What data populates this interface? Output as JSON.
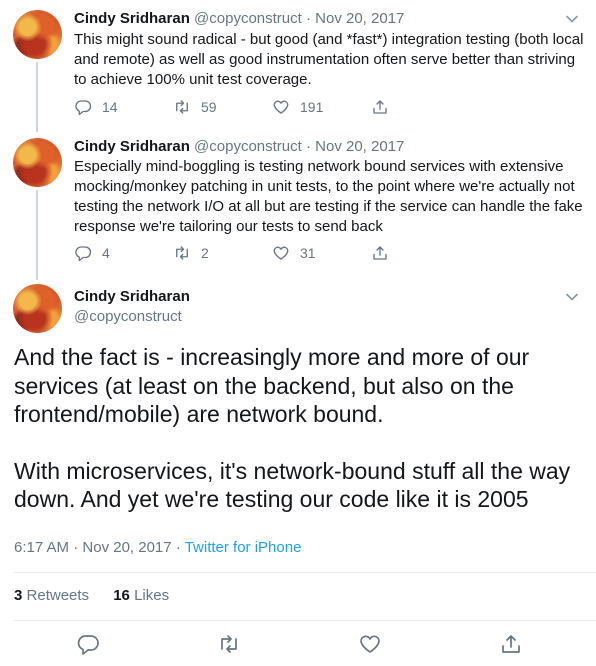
{
  "tweets": [
    {
      "name": "Cindy Sridharan",
      "handle": "@copyconstruct",
      "separator": "·",
      "date": "Nov 20, 2017",
      "text": "This might sound radical - but good (and *fast*) integration testing (both local and remote) as well as good instrumentation often serve better than striving to achieve 100% unit test coverage.",
      "replies": "14",
      "retweets": "59",
      "likes": "191"
    },
    {
      "name": "Cindy Sridharan",
      "handle": "@copyconstruct",
      "separator": "·",
      "date": "Nov 20, 2017",
      "text": "Especially mind-boggling is testing network bound services with extensive mocking/monkey patching in unit tests, to the point where we're actually not testing the network I/O at all but are testing if the service can handle the fake response we're tailoring our tests to send back",
      "replies": "4",
      "retweets": "2",
      "likes": "31"
    }
  ],
  "main_tweet": {
    "name": "Cindy Sridharan",
    "handle": "@copyconstruct",
    "paragraph1": "And the fact is - increasingly more and more of our services (at least on the backend, but also on the frontend/mobile) are network bound.",
    "paragraph2": "With microservices, it's network-bound stuff all the way down. And yet we're testing our code like it is 2005",
    "time": "6:17 AM",
    "separator1": "·",
    "date": "Nov 20, 2017",
    "separator2": "·",
    "source": "Twitter for iPhone",
    "retweet_count": "3",
    "retweet_label": "Retweets",
    "like_count": "16",
    "like_label": "Likes"
  },
  "icons": {
    "reply": "reply-icon",
    "retweet": "retweet-icon",
    "like": "heart-icon",
    "share": "share-icon",
    "caret": "chevron-down-icon"
  },
  "colors": {
    "text": "#14171a",
    "muted": "#657786",
    "link": "#1da1f2",
    "thread_line": "#ccd6dd",
    "divider": "#e6ecf0"
  }
}
